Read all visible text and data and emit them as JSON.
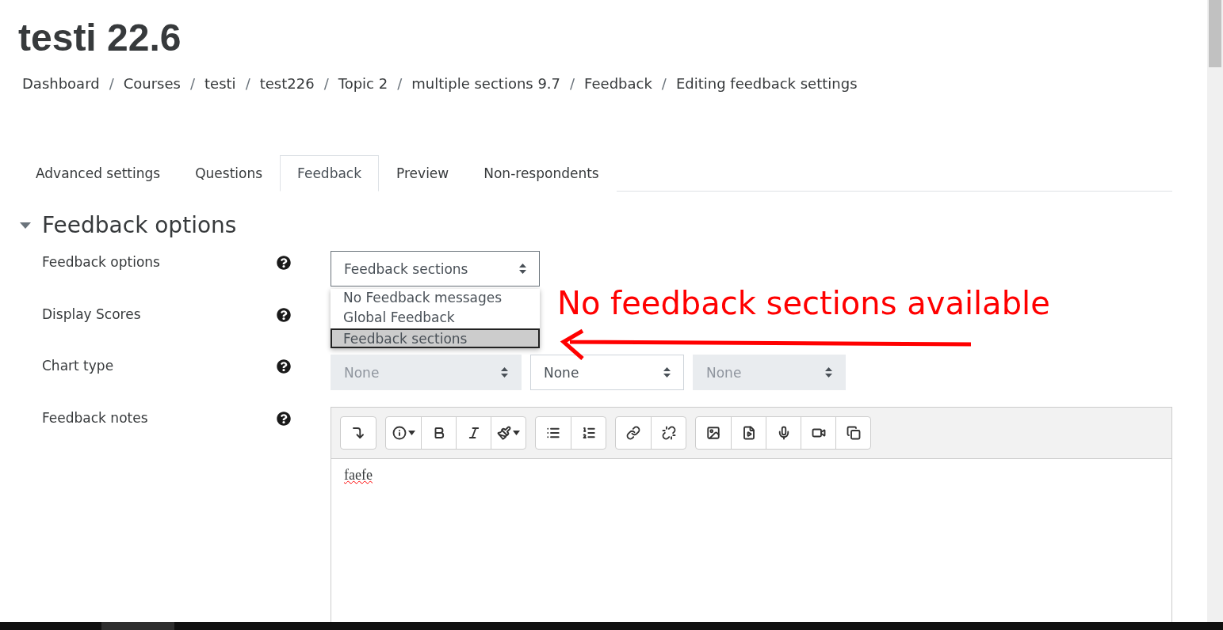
{
  "title": "testi 22.6",
  "breadcrumb": [
    {
      "label": "Dashboard"
    },
    {
      "separator": "/",
      "label": "Courses"
    },
    {
      "separator": "/",
      "label": "testi"
    },
    {
      "separator": "/",
      "label": "test226"
    },
    {
      "separator": "/",
      "label": "Topic 2"
    },
    {
      "separator": "/",
      "label": "multiple sections 9.7"
    },
    {
      "separator": "/",
      "label": "Feedback"
    },
    {
      "separator": "/",
      "label": "Editing feedback settings"
    }
  ],
  "tabs": [
    {
      "label": "Advanced settings",
      "selected": false
    },
    {
      "label": "Questions",
      "selected": false
    },
    {
      "label": "Feedback",
      "selected": true
    },
    {
      "label": "Preview",
      "selected": false
    },
    {
      "label": "Non-respondents",
      "selected": false
    }
  ],
  "section": {
    "title": "Feedback options",
    "expanded": true
  },
  "fields": [
    {
      "kind": "select",
      "label": "Feedback options",
      "value": "Feedback sections",
      "open": true,
      "options": [
        {
          "label": "No Feedback messages",
          "selected": false
        },
        {
          "label": "Global Feedback",
          "selected": false
        },
        {
          "label": "Feedback sections",
          "selected": true
        }
      ]
    },
    {
      "kind": "label",
      "label": "Display Scores"
    },
    {
      "kind": "selects",
      "label": "Chart type",
      "selects": [
        {
          "value": "None",
          "disabled": true
        },
        {
          "value": "None",
          "disabled": false
        },
        {
          "value": "None",
          "disabled": true
        }
      ]
    },
    {
      "kind": "editor",
      "label": "Feedback notes",
      "content": "faefe"
    }
  ],
  "annotation": {
    "text": "No feedback sections available"
  }
}
